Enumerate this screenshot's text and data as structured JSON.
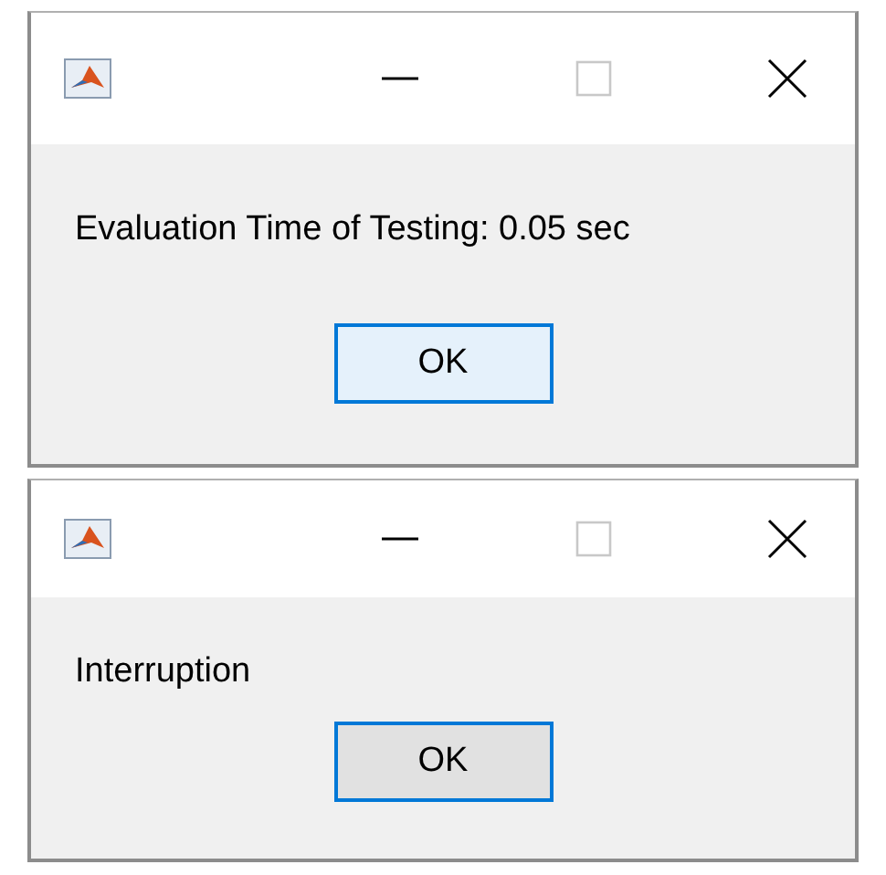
{
  "dialogs": [
    {
      "maximize_disabled": true,
      "message": "Evaluation Time of Testing: 0.05 sec",
      "button": {
        "label": "OK",
        "hovered": true
      }
    },
    {
      "maximize_disabled": true,
      "message": "Interruption",
      "button": {
        "label": "OK",
        "hovered": false
      }
    }
  ]
}
